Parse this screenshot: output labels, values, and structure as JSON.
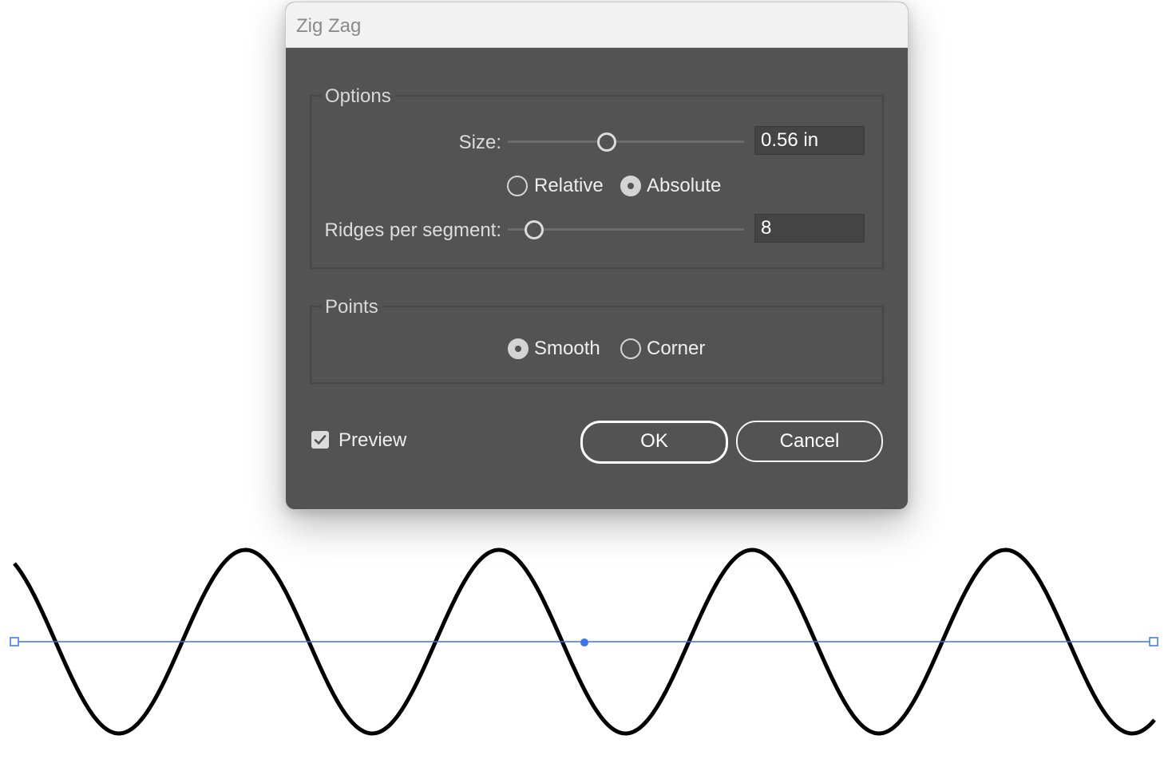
{
  "dialog": {
    "title": "Zig Zag",
    "options": {
      "legend": "Options",
      "size_label": "Size:",
      "size_value": "0.56 in",
      "size_slider_fraction": 0.42,
      "size_mode": {
        "relative_label": "Relative",
        "absolute_label": "Absolute",
        "selected": "Absolute"
      },
      "ridges_label": "Ridges per segment:",
      "ridges_value": "8",
      "ridges_slider_fraction": 0.11
    },
    "points": {
      "legend": "Points",
      "smooth_label": "Smooth",
      "corner_label": "Corner",
      "selected": "Smooth"
    },
    "preview": {
      "label": "Preview",
      "checked": true
    },
    "buttons": {
      "ok_label": "OK",
      "cancel_label": "Cancel"
    }
  },
  "canvas": {
    "wave_color": "#000000",
    "path_color": "#3b73f0",
    "anchor_color": "#3b73f0"
  }
}
